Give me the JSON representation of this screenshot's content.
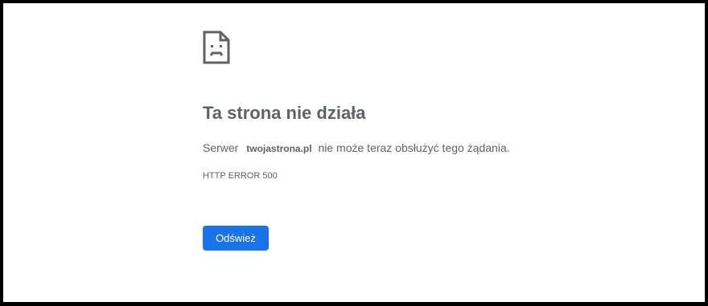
{
  "error_page": {
    "icon": "sad-page-icon",
    "title": "Ta strona nie działa",
    "message_prefix": "Serwer",
    "host": "twojastrona.pl",
    "message_suffix": "nie może teraz obsłużyć tego żądania.",
    "error_code": "HTTP ERROR 500",
    "reload_label": "Odśwież"
  },
  "colors": {
    "accent": "#1a73e8",
    "text": "#5f6368",
    "background": "#ffffff",
    "frame": "#000000"
  }
}
